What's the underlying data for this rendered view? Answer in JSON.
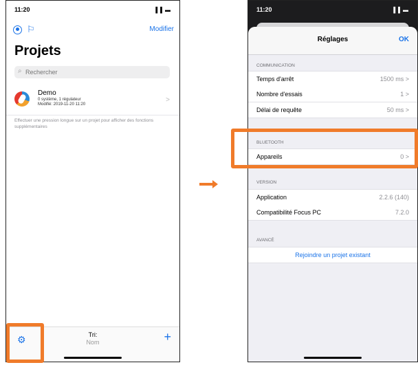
{
  "left": {
    "status": {
      "time": "11:20",
      "signal": "▐▐",
      "battery": "▬"
    },
    "toolbar": {
      "user_icon": "user-circle-icon",
      "flag_icon": "flag-icon",
      "flag_glyph": "⚐",
      "modifier_label": "Modifier"
    },
    "title": "Projets",
    "search": {
      "icon_glyph": "⌕",
      "placeholder": "Rechercher"
    },
    "project": {
      "name": "Demo",
      "meta1": "0 système, 1 régulateur",
      "meta2": "Modifié: 2019-11-20 11:20",
      "chevron": ">"
    },
    "hint": "Effectuer une pression longue sur un projet pour afficher des fonctions supplémentaires",
    "bottom": {
      "gear_glyph": "⚙",
      "sort_label": "Tri:",
      "sort_value": "Nom",
      "plus_glyph": "+"
    }
  },
  "right": {
    "status": {
      "time": "11:20",
      "signal": "▐▐",
      "battery": "▬"
    },
    "nav": {
      "title": "Réglages",
      "ok_label": "OK"
    },
    "sections": {
      "communication": {
        "header": "COMMUNICATION",
        "rows": [
          {
            "label": "Temps d'arrêt",
            "value": "1500 ms >"
          },
          {
            "label": "Nombre d'essais",
            "value": "1 >"
          },
          {
            "label": "Délai de requête",
            "value": "50 ms >"
          }
        ]
      },
      "bluetooth": {
        "header": "BLUETOOTH",
        "rows": [
          {
            "label": "Appareils",
            "value": "0 >"
          }
        ]
      },
      "version": {
        "header": "VERSION",
        "rows": [
          {
            "label": "Application",
            "value": "2.2.6 (140)"
          },
          {
            "label": "Compatibilité Focus PC",
            "value": "7.2.0"
          }
        ]
      },
      "advanced": {
        "header": "AVANCÉ",
        "action": "Rejoindre un projet existant"
      }
    }
  },
  "colors": {
    "accent": "#1a73e8",
    "highlight": "#f07b2a"
  }
}
